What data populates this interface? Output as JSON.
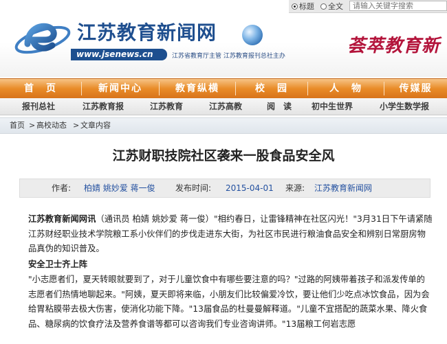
{
  "search": {
    "option_title": "标题",
    "option_fulltext": "全文",
    "placeholder": "请输入关键字搜索"
  },
  "header": {
    "site_name": "江苏教育新闻网",
    "url": "www.jsenews.cn",
    "sponsor": "江苏省教育厅主管  江苏教育报刊总社主办",
    "slogan": "荟萃教育新"
  },
  "main_nav": [
    "首　页",
    "新闻中心",
    "教育纵横",
    "校　园",
    "人　物",
    "传媒服"
  ],
  "sub_nav": [
    "报刊总社",
    "江苏教育报",
    "江苏教育",
    "江苏高教",
    "阅　读",
    "初中生世界",
    "小学生数学报"
  ],
  "breadcrumb": [
    "首页",
    "高校动态",
    "文章内容"
  ],
  "breadcrumb_sep": ">",
  "article": {
    "title": "江苏财职技院社区袭来一股食品安全风",
    "author_label": "作者:",
    "author": "柏婧 姚妙爱 蒋一俊",
    "time_label": "发布时间:",
    "time": "2015-04-01",
    "source_label": "来源:",
    "source": "江苏教育新闻网",
    "lead_source": "江苏教育新闻网讯",
    "lead_rest": "（通讯员 柏婧 姚妙爱 蒋一俊）\"相约春日，让雷锋精神在社区闪光！\"3月31日下午请紧随江苏财经职业技术学院粮工系小伙伴们的步伐走进东大街，为社区市民进行粮油食品安全和辨别日常厨房物品真伪的知识普及。",
    "section_heading": "安全卫士齐上阵",
    "paragraph": "\"小志愿者们，夏天转眼就要到了，对于儿童饮食中有哪些要注意的吗？\"过路的阿姨带着孩子和派发传单的志愿者们热情地聊起来。\"阿姨，夏天即将来临，小朋友们比较偏爱冷饮，要让他们少吃点冰饮食品，因为会给胃粘膜带去极大伤害，使消化功能下降。\"13届食品的杜曼曼解释道。\"儿童不宜搭配的蔬菜水果、降火食品、糖尿病的饮食疗法及营养食谱等都可以咨询我们专业咨询讲师。\"13届粮工何岩志愿"
  },
  "colors": {
    "nav_orange": "#e98c28",
    "brand_blue": "#1f4f8f",
    "slogan_red": "#b3143b",
    "link_blue": "#2451a0"
  }
}
